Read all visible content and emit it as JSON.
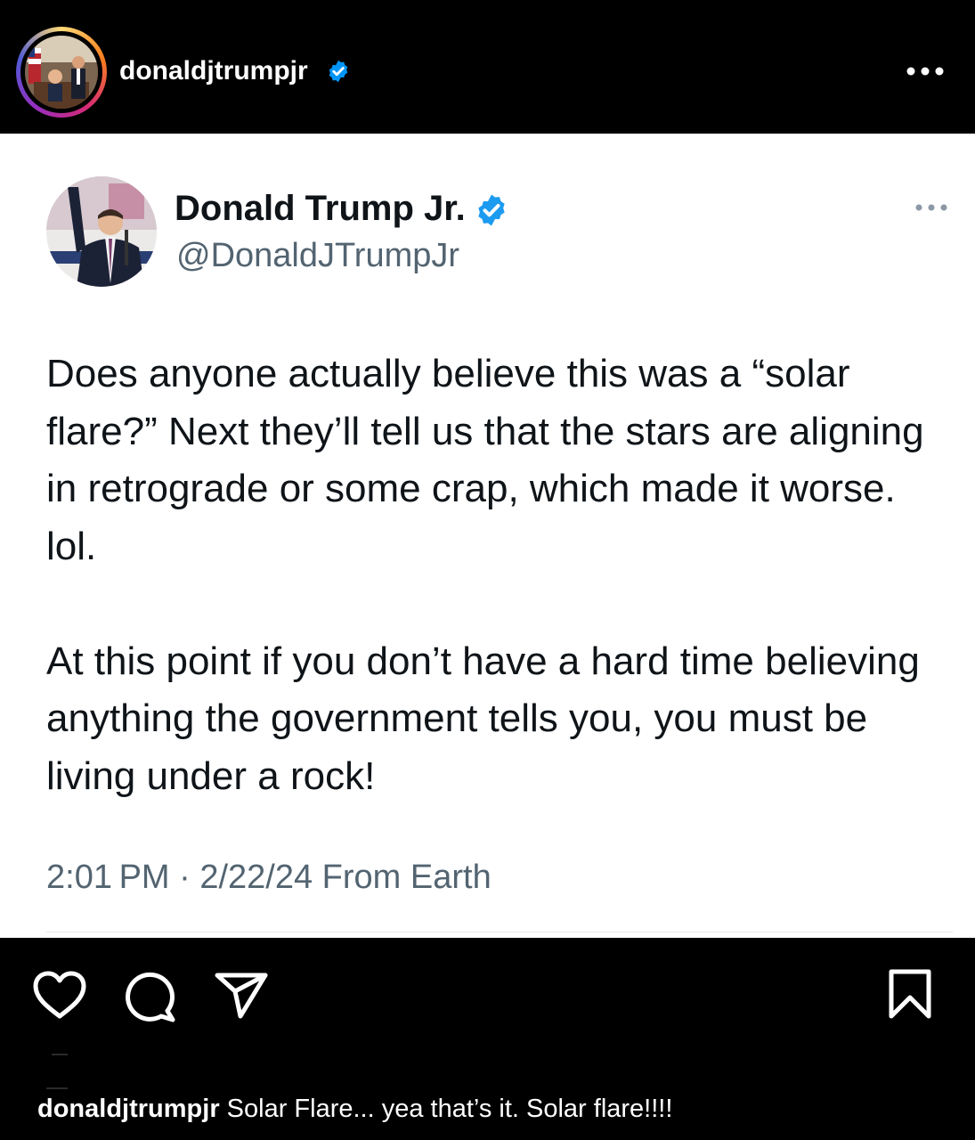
{
  "ig_header": {
    "username": "donaldjtrumpjr"
  },
  "tweet": {
    "display_name": "Donald Trump Jr.",
    "handle": "@DonaldJTrumpJr",
    "body": "Does anyone actually believe this was a “solar flare?” Next they’ll tell us that the stars are aligning in retrograde or some crap, which made it worse. lol.\n\nAt this point if you don’t have a hard time believing anything the government tells you, you must be living under a rock!",
    "meta": "2:01 PM · 2/22/24 From Earth"
  },
  "caption": {
    "username": "donaldjtrumpjr",
    "text": " Solar Flare... yea that’s it. Solar flare!!!!"
  },
  "icons": {
    "verified": "verified-badge-icon",
    "more": "more-horizontal-icon",
    "like": "heart-icon",
    "comment": "comment-bubble-icon",
    "share": "paper-plane-icon",
    "save": "bookmark-icon"
  },
  "colors": {
    "verified_blue": "#1d9bf0",
    "ig_verified_blue": "#0095f6",
    "secondary_text": "#536471"
  }
}
